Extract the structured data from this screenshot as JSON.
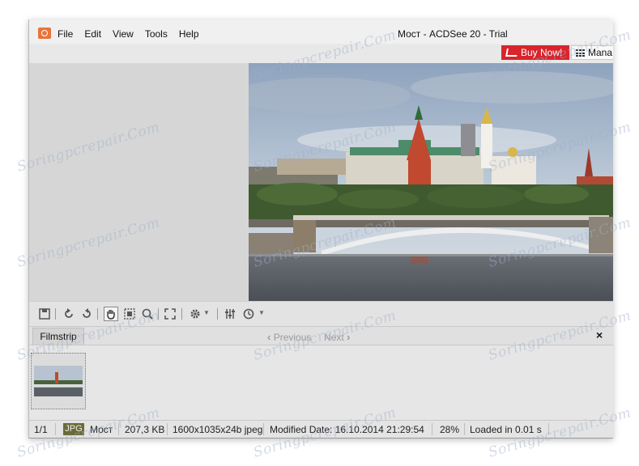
{
  "window": {
    "title": "Мост - ACDSee 20 - Trial"
  },
  "menu": [
    "File",
    "Edit",
    "View",
    "Tools",
    "Help"
  ],
  "header_buttons": {
    "buy_now": "Buy Now!",
    "manage": "Mana"
  },
  "filmstrip": {
    "tab_label": "Filmstrip",
    "previous": "Previous",
    "next": "Next",
    "close": "×"
  },
  "status": {
    "position": "1/1",
    "format": "JPG",
    "filename": "Мост",
    "filesize": "207,3 KB",
    "dimensions": "1600x1035x24b jpeg",
    "modified": "Modified Date: 16.10.2014 21:29:54",
    "zoom": "28%",
    "load_time": "Loaded in 0.01 s"
  },
  "watermark": "Soringpcrepair.Com",
  "toolbar_icons": [
    "save-icon",
    "rotate-left-icon",
    "rotate-right-icon",
    "hand-pan-icon",
    "select-icon",
    "zoom-icon",
    "fullscreen-icon",
    "settings-icon",
    "adjust-icon",
    "clock-icon"
  ],
  "colors": {
    "buy_now": "#d8242c",
    "jpg_badge": "#6b6b3a",
    "app_icon": "#e8743b"
  }
}
